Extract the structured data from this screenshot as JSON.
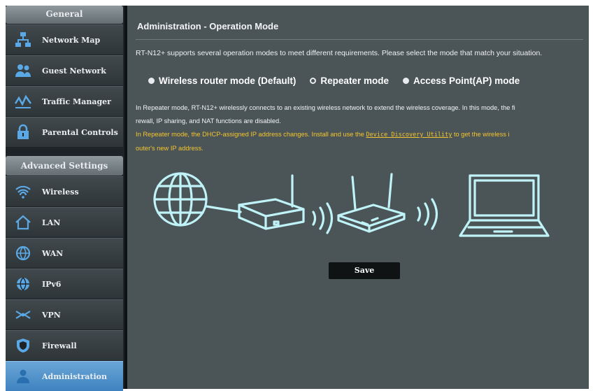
{
  "sidebar": {
    "general_header": "General",
    "general_items": [
      {
        "label": "Network Map",
        "icon": "network-map-icon"
      },
      {
        "label": "Guest Network",
        "icon": "guest-network-icon"
      },
      {
        "label": "Traffic Manager",
        "icon": "traffic-manager-icon"
      },
      {
        "label": "Parental Controls",
        "icon": "lock-icon"
      }
    ],
    "advanced_header": "Advanced Settings",
    "advanced_items": [
      {
        "label": "Wireless",
        "icon": "wifi-icon"
      },
      {
        "label": "LAN",
        "icon": "home-icon"
      },
      {
        "label": "WAN",
        "icon": "globe-icon"
      },
      {
        "label": "IPv6",
        "icon": "globe-icon"
      },
      {
        "label": "VPN",
        "icon": "vpn-icon"
      },
      {
        "label": "Firewall",
        "icon": "shield-icon"
      },
      {
        "label": "Administration",
        "icon": "administration-icon",
        "active": true
      }
    ]
  },
  "main": {
    "title": "Administration - Operation Mode",
    "intro": "RT-N12+ supports several operation modes to meet different requirements. Please select the mode that match your situation.",
    "modes": [
      {
        "label": "Wireless router mode (Default)",
        "selected": true
      },
      {
        "label": "Repeater mode",
        "selected": false
      },
      {
        "label": "Access Point(AP) mode",
        "selected": true
      }
    ],
    "description_line1": "In Repeater mode, RT-N12+ wirelessly connects to an existing wireless network to extend the wireless coverage. In this mode, the fi",
    "description_line2": "rewall, IP sharing, and NAT functions are disabled.",
    "note_line1_before": "In Repeater mode, the DHCP-assigned IP address changes. Install and use the ",
    "note_link": "Device Discovery Utility",
    "note_line1_after": " to get the wireless i",
    "note_line2": "outer's new IP address.",
    "save_label": "Save"
  },
  "colors": {
    "sidebar_bg": "#1d2326",
    "main_bg": "#4b5558",
    "active_item": "#4f93cd",
    "note_text": "#f4c52e",
    "diagram_outline": "#bff3f8"
  }
}
